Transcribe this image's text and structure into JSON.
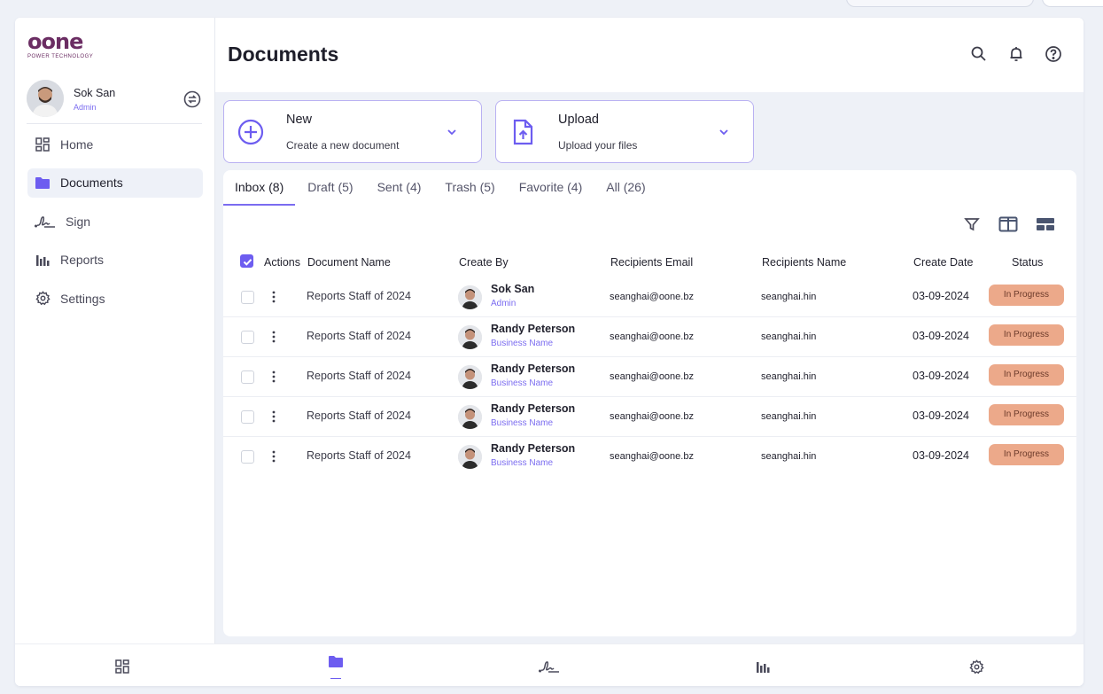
{
  "brand": {
    "logo_text": "oone",
    "logo_subtitle": "POWER TECHNOLOGY",
    "color": "#6b2d63"
  },
  "user": {
    "name": "Sok San",
    "role": "Admin"
  },
  "sidebar": {
    "items": [
      {
        "label": "Home",
        "icon": "grid-icon"
      },
      {
        "label": "Documents",
        "icon": "folder-icon",
        "active": true
      },
      {
        "label": "Sign",
        "icon": "signature-icon"
      },
      {
        "label": "Reports",
        "icon": "bar-chart-icon"
      },
      {
        "label": "Settings",
        "icon": "gear-icon"
      }
    ]
  },
  "header": {
    "title": "Documents",
    "icons": [
      "search-icon",
      "bell-icon",
      "help-icon"
    ]
  },
  "actions": {
    "new": {
      "title": "New",
      "subtitle": "Create a new document"
    },
    "upload": {
      "title": "Upload",
      "subtitle": "Upload your files"
    }
  },
  "tabs": [
    {
      "label": "Inbox (8)",
      "active": true
    },
    {
      "label": "Draft (5)"
    },
    {
      "label": "Sent (4)"
    },
    {
      "label": "Trash (5)"
    },
    {
      "label": "Favorite (4)"
    },
    {
      "label": "All (26)"
    }
  ],
  "table": {
    "columns": [
      "Actions",
      "Document Name",
      "Create By",
      "Recipients Email",
      "Recipients Name",
      "Create Date",
      "Status"
    ],
    "rows": [
      {
        "document": "Reports Staff of 2024",
        "creator": "Sok San",
        "creator_sub": "Admin",
        "email": "seanghai@oone.bz",
        "recipient": "seanghai.hin",
        "date": "03-09-2024",
        "status": "In Progress"
      },
      {
        "document": "Reports Staff of 2024",
        "creator": "Randy Peterson",
        "creator_sub": "Business Name",
        "email": "seanghai@oone.bz",
        "recipient": "seanghai.hin",
        "date": "03-09-2024",
        "status": "In Progress"
      },
      {
        "document": "Reports Staff of 2024",
        "creator": "Randy Peterson",
        "creator_sub": "Business Name",
        "email": "seanghai@oone.bz",
        "recipient": "seanghai.hin",
        "date": "03-09-2024",
        "status": "In Progress"
      },
      {
        "document": "Reports Staff of 2024",
        "creator": "Randy Peterson",
        "creator_sub": "Business Name",
        "email": "seanghai@oone.bz",
        "recipient": "seanghai.hin",
        "date": "03-09-2024",
        "status": "In Progress"
      },
      {
        "document": "Reports Staff of 2024",
        "creator": "Randy Peterson",
        "creator_sub": "Business Name",
        "email": "seanghai@oone.bz",
        "recipient": "seanghai.hin",
        "date": "03-09-2024",
        "status": "In Progress"
      }
    ]
  },
  "colors": {
    "accent": "#6d5df0",
    "status_in_progress": "#eca98a",
    "background": "#eef1f7"
  }
}
